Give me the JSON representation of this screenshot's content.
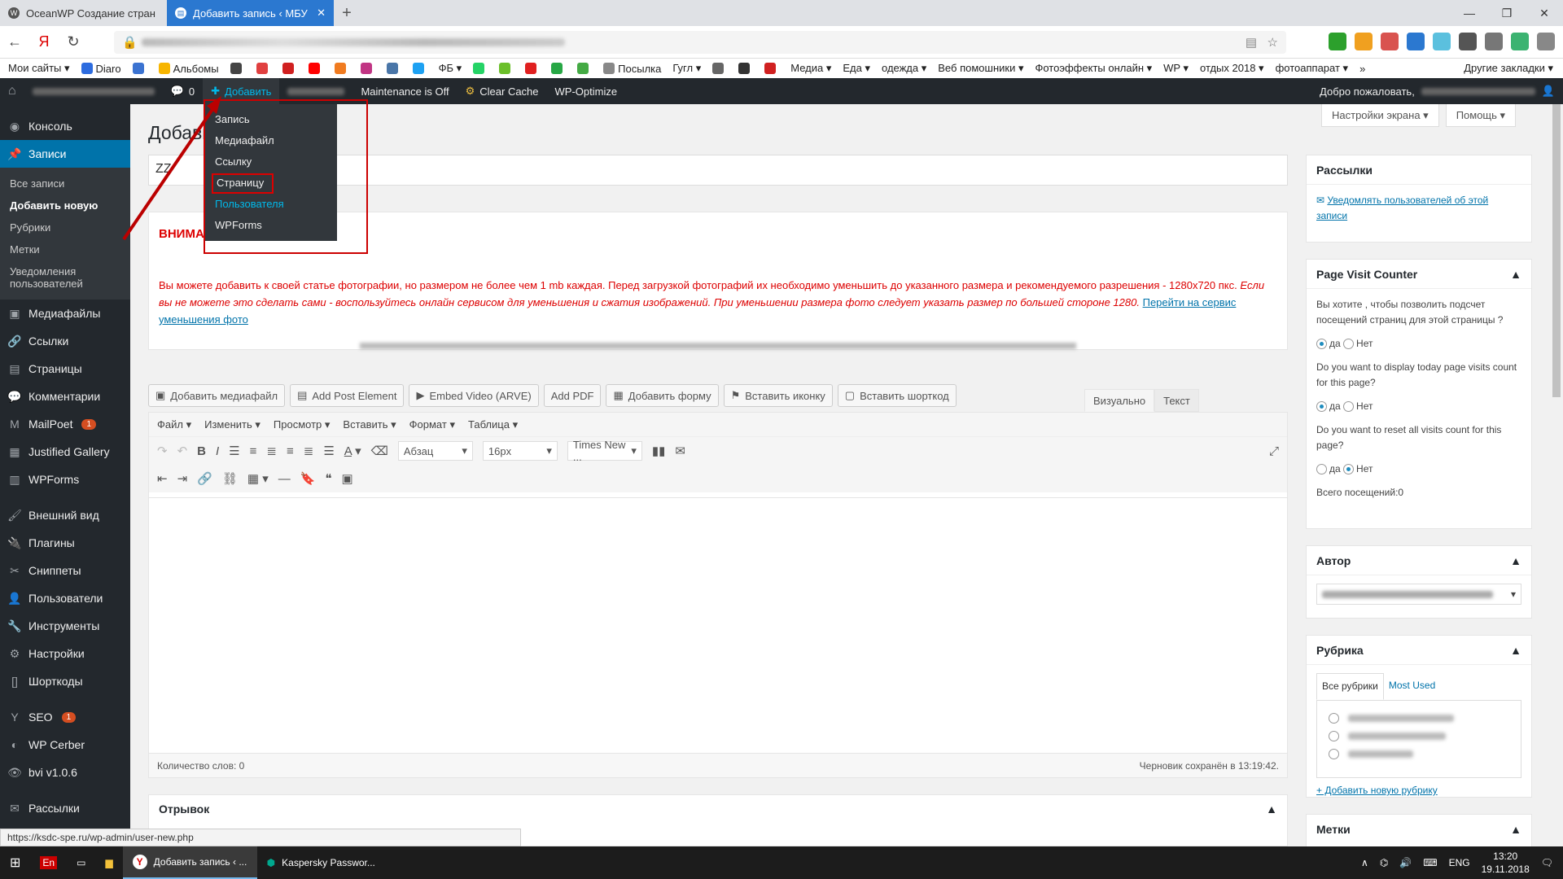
{
  "browser": {
    "tabs": [
      {
        "label": "OceanWP Создание стран",
        "active": false
      },
      {
        "label": "Добавить запись ‹ МБУ",
        "active": true
      }
    ],
    "new_tab": "+",
    "window_controls": [
      "—",
      "❐",
      "✕"
    ],
    "bookmarks": [
      {
        "label": "Мои сайты ▾",
        "color": ""
      },
      {
        "label": "Diaro",
        "color": "#2d6cdf"
      },
      {
        "label": "",
        "color": "#3b73d1"
      },
      {
        "label": "Альбомы",
        "color": "#f7b500"
      },
      {
        "label": "",
        "color": "#444"
      },
      {
        "label": "",
        "color": "#e04040"
      },
      {
        "label": "",
        "color": "#d02020"
      },
      {
        "label": "",
        "color": "#ff0000"
      },
      {
        "label": "",
        "color": "#f07b20"
      },
      {
        "label": "",
        "color": "#c13584"
      },
      {
        "label": "",
        "color": "#4a76a8"
      },
      {
        "label": "",
        "color": "#1da1f2"
      },
      {
        "label": "ФБ ▾",
        "color": ""
      },
      {
        "label": "",
        "color": "#25d366"
      },
      {
        "label": "",
        "color": "#6bbf2a"
      },
      {
        "label": "",
        "color": "#e02020"
      },
      {
        "label": "",
        "color": "#27a745"
      },
      {
        "label": "",
        "color": "#44aa44"
      },
      {
        "label": "Посылка",
        "color": "#888"
      },
      {
        "label": "Гугл ▾",
        "color": ""
      },
      {
        "label": "",
        "color": "#666"
      },
      {
        "label": "",
        "color": "#333"
      },
      {
        "label": "",
        "color": "#d02020"
      },
      {
        "label": "Медиа ▾",
        "color": ""
      },
      {
        "label": "Еда ▾",
        "color": ""
      },
      {
        "label": "одежда ▾",
        "color": ""
      },
      {
        "label": "Веб помошники ▾",
        "color": ""
      },
      {
        "label": "Фотоэффекты онлайн ▾",
        "color": ""
      },
      {
        "label": "WP ▾",
        "color": ""
      },
      {
        "label": "отдых 2018 ▾",
        "color": ""
      },
      {
        "label": "фотоаппарат ▾",
        "color": ""
      },
      {
        "label": "»",
        "color": ""
      }
    ],
    "bookmark_other": "Другие закладки ▾",
    "ext_colors": [
      "#2ca02c",
      "#f0a020",
      "#d9534f",
      "#2b78d0",
      "#5bc0de",
      "#555",
      "#777",
      "#3cb371",
      "#888"
    ]
  },
  "adminbar": {
    "comments_count": "0",
    "add_label": "Добавить",
    "maintenance": "Maintenance is Off",
    "clear_cache": "Clear Cache",
    "wp_optimize": "WP-Optimize",
    "welcome": "Добро пожаловать,"
  },
  "add_menu": {
    "items": [
      {
        "label": "Запись",
        "highlight": false,
        "boxed": false
      },
      {
        "label": "Медиафайл",
        "highlight": false,
        "boxed": false
      },
      {
        "label": "Ссылку",
        "highlight": false,
        "boxed": false
      },
      {
        "label": "Страницу",
        "highlight": false,
        "boxed": true
      },
      {
        "label": "Пользователя",
        "highlight": true,
        "boxed": false
      },
      {
        "label": "WPForms",
        "highlight": false,
        "boxed": false
      }
    ]
  },
  "sidebar": {
    "items": [
      {
        "label": "Консоль",
        "icon": "dashboard-icon"
      },
      {
        "label": "Записи",
        "icon": "pin-icon",
        "active": true
      },
      {
        "label": "Медиафайлы",
        "icon": "media-icon"
      },
      {
        "label": "Ссылки",
        "icon": "link-icon"
      },
      {
        "label": "Страницы",
        "icon": "page-icon"
      },
      {
        "label": "Комментарии",
        "icon": "comment-icon"
      },
      {
        "label": "MailPoet",
        "icon": "mailpoet-icon",
        "badge": "1"
      },
      {
        "label": "Justified Gallery",
        "icon": "gallery-icon"
      },
      {
        "label": "WPForms",
        "icon": "forms-icon"
      },
      {
        "label": "Внешний вид",
        "icon": "brush-icon"
      },
      {
        "label": "Плагины",
        "icon": "plugin-icon"
      },
      {
        "label": "Сниппеты",
        "icon": "snippet-icon"
      },
      {
        "label": "Пользователи",
        "icon": "users-icon"
      },
      {
        "label": "Инструменты",
        "icon": "tools-icon"
      },
      {
        "label": "Настройки",
        "icon": "settings-icon"
      },
      {
        "label": "Шорткоды",
        "icon": "shortcode-icon"
      },
      {
        "label": "SEO",
        "icon": "seo-icon",
        "badge": "1"
      },
      {
        "label": "WP Cerber",
        "icon": "cerber-icon"
      },
      {
        "label": "bvi v1.0.6",
        "icon": "eye-icon"
      },
      {
        "label": "Рассылки",
        "icon": "mail-icon"
      }
    ],
    "sub": [
      "Все записи",
      "Добавить новую",
      "Рубрики",
      "Метки",
      "Уведомления пользователей"
    ]
  },
  "main": {
    "page_title": "Добави",
    "title_value": "ZZ",
    "notice_heading": "ВНИМА",
    "notice_text": "Вы можете добавить к своей статье фотографии, но размером не более чем 1 mb каждая. Перед загрузкой фотографий их необходимо уменьшить до указанного размера и рекомендуемого разрешения - 1280х720 пкс.",
    "notice_italic": "Если вы не можете это сделать сами - воспользуйтесь онлайн сервисом для уменьшения и сжатия изображений. При уменьшении размера фото следует указать размер по большей стороне 1280.",
    "notice_link": "Перейти на сервис уменьшения фото",
    "media_buttons": [
      "Добавить медиафайл",
      "Add Post Element",
      "Embed Video (ARVE)",
      "Add PDF",
      "Добавить форму",
      "Вставить иконку",
      "Вставить шорткод"
    ],
    "editor_tabs": [
      "Визуально",
      "Текст"
    ],
    "menu": [
      "Файл ▾",
      "Изменить ▾",
      "Просмотр ▾",
      "Вставить ▾",
      "Формат ▾",
      "Таблица ▾"
    ],
    "format_select": "Абзац",
    "size_select": "16px",
    "font_select": "Times New ...",
    "word_count": "Количество слов: 0",
    "draft_saved": "Черновик сохранён в 13:19:42.",
    "excerpt_title": "Отрывок"
  },
  "right": {
    "screen_options": "Настройки экрана ▾",
    "help": "Помощь ▾",
    "mailings_title": "Рассылки",
    "mailings_link": "Уведомлять пользователей об этой записи",
    "pvc_title": "Page Visit Counter",
    "pvc_q1": "Вы хотите , чтобы позволить подсчет посещений страниц для этой страницы ?",
    "pvc_q2": "Do you want to display today page visits count for this page?",
    "pvc_q3": "Do you want to reset all visits count for this page?",
    "yes": "да",
    "no": "Нет",
    "pvc_total": "Всего посещений:0",
    "author_title": "Автор",
    "rubric_title": "Рубрика",
    "rubric_tab_all": "Все рубрики",
    "rubric_tab_used": "Most Used",
    "add_rubric": "+ Добавить новую рубрику",
    "tags_title": "Метки"
  },
  "status_url": "https://ksdc-spe.ru/wp-admin/user-new.php",
  "taskbar": {
    "lang": "En",
    "apps": [
      "Добавить запись ‹ ...",
      "Kaspersky Passwor..."
    ],
    "tray_lang": "ENG",
    "time": "13:20",
    "date": "19.11.2018"
  }
}
